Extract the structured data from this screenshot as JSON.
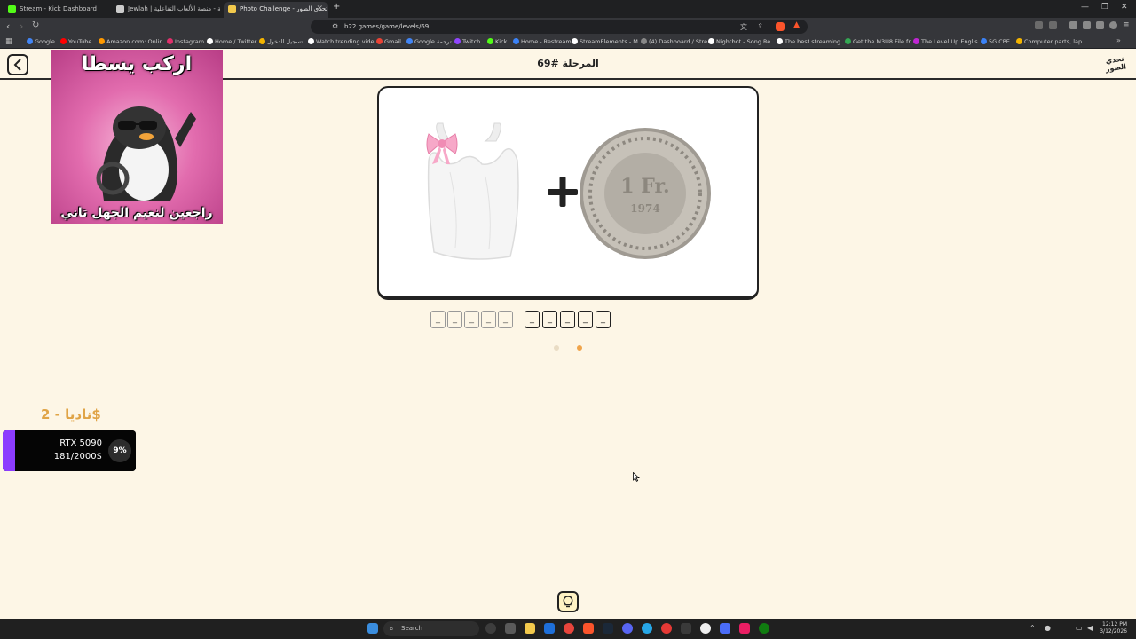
{
  "browser": {
    "tabs": [
      {
        "title": "Stream - Kick Dashboard",
        "color": "#53fc18",
        "active": false
      },
      {
        "title": "Jewlah | جولة - منصة الألعاب التفاعلية",
        "color": "#cccccc",
        "active": false
      },
      {
        "title": "Photo Challenge - تحدي الصور",
        "color": "#f2c94c",
        "active": true
      }
    ],
    "new_tab": "+",
    "url": "b22.games/game/levels/69",
    "bookmarks": [
      {
        "label": "Google",
        "color": "#4285f4"
      },
      {
        "label": "YouTube",
        "color": "#ff0000"
      },
      {
        "label": "Amazon.com: Onlin...",
        "color": "#ff9900"
      },
      {
        "label": "Instagram",
        "color": "#e1306c"
      },
      {
        "label": "Home / Twitter",
        "color": "#ffffff"
      },
      {
        "label": "تسجيل الدخول",
        "color": "#f4b400"
      },
      {
        "label": "Watch trending vide...",
        "color": "#ffffff"
      },
      {
        "label": "Gmail",
        "color": "#ea4335"
      },
      {
        "label": "Google ترجمة",
        "color": "#4285f4"
      },
      {
        "label": "Twitch",
        "color": "#9146ff"
      },
      {
        "label": "Kick",
        "color": "#53fc18"
      },
      {
        "label": "Home - Restream",
        "color": "#3b82f6"
      },
      {
        "label": "StreamElements - M...",
        "color": "#ffffff"
      },
      {
        "label": "(4) Dashboard / Stre...",
        "color": "#888888"
      },
      {
        "label": "Nightbot - Song Re...",
        "color": "#ffffff"
      },
      {
        "label": "The best streaming...",
        "color": "#ffffff"
      },
      {
        "label": "Get the M3U8 File fr...",
        "color": "#34a853"
      },
      {
        "label": "The Level Up Englis...",
        "color": "#c026d3"
      },
      {
        "label": "5G CPE",
        "color": "#3b82f6"
      },
      {
        "label": "Computer parts, lap...",
        "color": "#f4b400"
      }
    ]
  },
  "page": {
    "level_title": "المرحلة #69",
    "logo_text": "تحدي الصور"
  },
  "meme": {
    "top_text": "اركب يسطا",
    "bottom_text": "راجعين لنعيم الجهل تاني"
  },
  "puzzle": {
    "operator": "+",
    "answer_slots": [
      "_",
      "_",
      "_",
      "_",
      "_",
      "_",
      "_",
      "_",
      "_",
      "_"
    ],
    "current_page_dot": 2
  },
  "donation": {
    "donor": "ناديا - 2$",
    "goal_name": "RTX 5090",
    "goal_amount": "181/2000$",
    "goal_percent": "9%",
    "goal_fraction": 0.09
  },
  "taskbar": {
    "search_label": "Search",
    "time": "12:12 PM",
    "date": "3/12/2026"
  }
}
